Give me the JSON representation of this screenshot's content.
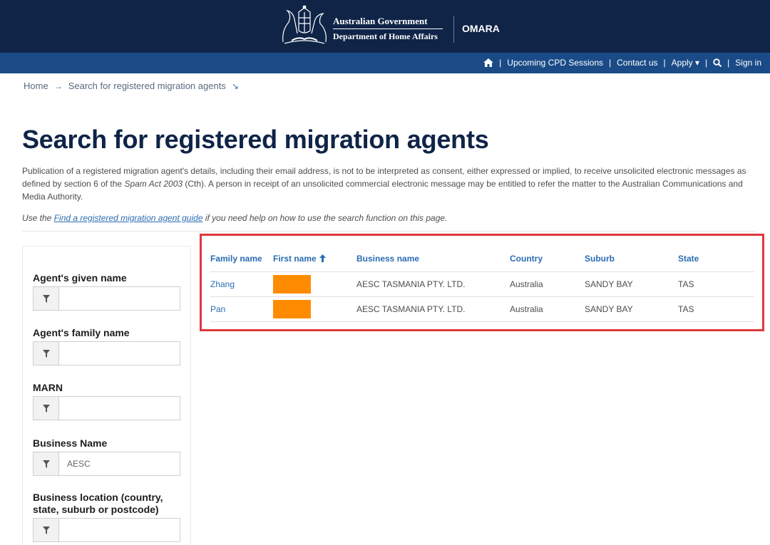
{
  "header": {
    "gov_line1": "Australian Government",
    "gov_line2": "Department of Home Affairs",
    "app_name": "OMARA",
    "colors": {
      "navy": "#0f2447",
      "nav_blue": "#1a4b87",
      "link": "#2a6db3",
      "highlight": "#e0373d",
      "redaction": "#ff8c00"
    }
  },
  "nav": {
    "home_icon": "home-icon",
    "items": [
      "Upcoming CPD Sessions",
      "Contact us",
      "Apply"
    ],
    "apply_caret": "▾",
    "search_icon": "search-icon",
    "sign_in": "Sign in"
  },
  "breadcrumb": {
    "home": "Home",
    "current": "Search for registered migration agents"
  },
  "page": {
    "title": "Search for registered migration agents",
    "intro_part1": "Publication of a registered migration agent's details, including their email address, is not to be interpreted as consent, either expressed or implied, to receive unsolicited electronic messages as defined by section 6 of the ",
    "intro_italic": "Spam Act 2003",
    "intro_part2": " (Cth). A person in receipt of an unsolicited commercial electronic message may be entitled to refer the matter to the Australian Communications and Media Authority.",
    "guide_prefix": "Use the ",
    "guide_link": "Find a registered migration agent guide",
    "guide_suffix": " if you need help on how to use the search function on this page."
  },
  "filters": [
    {
      "label": "Agent's given name",
      "value": ""
    },
    {
      "label": "Agent's family name",
      "value": ""
    },
    {
      "label": "MARN",
      "value": ""
    },
    {
      "label": "Business Name",
      "value": "AESC"
    },
    {
      "label": "Business location (country, state, suburb or postcode)",
      "value": ""
    }
  ],
  "results": {
    "columns": [
      "Family name",
      "First name",
      "Business name",
      "Country",
      "Suburb",
      "State"
    ],
    "sorted_column": "First name",
    "rows": [
      {
        "family": "Zhang",
        "business": "AESC TASMANIA PTY. LTD.",
        "country": "Australia",
        "suburb": "SANDY BAY",
        "state": "TAS"
      },
      {
        "family": "Pan",
        "business": "AESC TASMANIA PTY. LTD.",
        "country": "Australia",
        "suburb": "SANDY BAY",
        "state": "TAS"
      }
    ]
  }
}
